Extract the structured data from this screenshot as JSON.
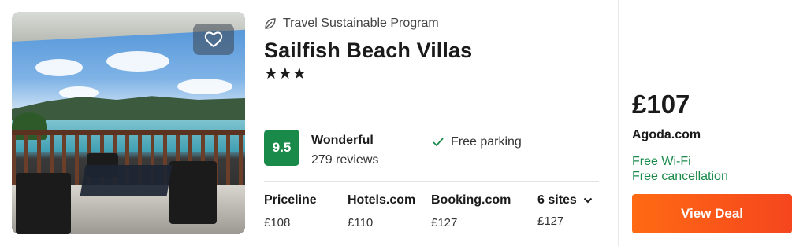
{
  "program": {
    "label": "Travel Sustainable Program",
    "icon": "leaf-icon"
  },
  "hotel": {
    "name": "Sailfish Beach Villas",
    "star_count": 3,
    "stars": "★★★"
  },
  "rating": {
    "score": "9.5",
    "word": "Wonderful",
    "reviews": "279 reviews",
    "badge_color": "#1a8a4a"
  },
  "amenity": {
    "label": "Free parking",
    "icon": "check-icon"
  },
  "sites": [
    {
      "name": "Priceline",
      "price": "£108"
    },
    {
      "name": "Hotels.com",
      "price": "£110"
    },
    {
      "name": "Booking.com",
      "price": "£127"
    }
  ],
  "more_sites": {
    "label": "6 sites",
    "price": "£127",
    "icon": "chevron-down-icon"
  },
  "deal": {
    "price": "£107",
    "provider": "Agoda.com",
    "perks": [
      "Free Wi-Fi",
      "Free cancellation"
    ],
    "button_label": "View Deal",
    "button_color": "#f5461e",
    "perk_color": "#1a8a4a"
  },
  "favorite": {
    "icon": "heart-icon"
  }
}
